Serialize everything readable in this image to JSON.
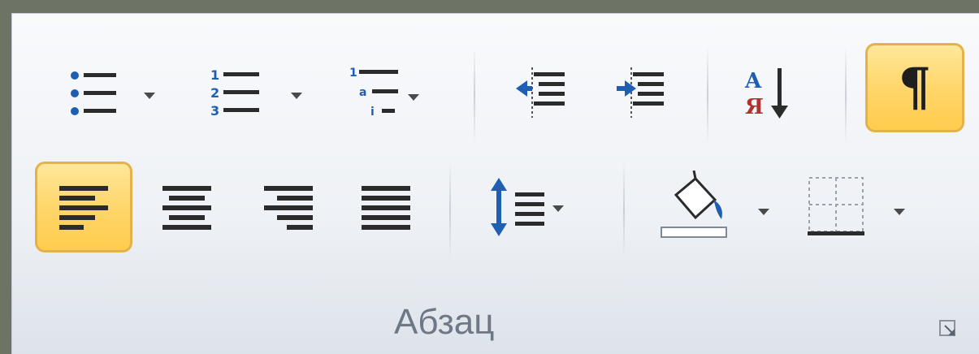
{
  "group": {
    "label": "Абзац"
  },
  "buttons": {
    "bullets": "bullets-button",
    "numbering": "numbering-button",
    "multilevel": "multilevel-list-button",
    "decrease_indent": "decrease-indent-button",
    "increase_indent": "increase-indent-button",
    "sort": {
      "letter_top": "A",
      "letter_bottom": "Я"
    },
    "show_marks": {
      "glyph": "¶",
      "active": true
    },
    "align_left": {
      "active": true
    },
    "align_center": {
      "active": false
    },
    "align_right": {
      "active": false
    },
    "justify": {
      "active": false
    },
    "line_spacing": "line-spacing-button",
    "shading": "shading-button",
    "borders": "borders-button"
  },
  "colors": {
    "active_fill": "#ffd66b",
    "active_border": "#e3b24c",
    "icon_blue": "#1f5fb3",
    "icon_dark": "#2b2b2b",
    "sort_red": "#b0322c"
  }
}
